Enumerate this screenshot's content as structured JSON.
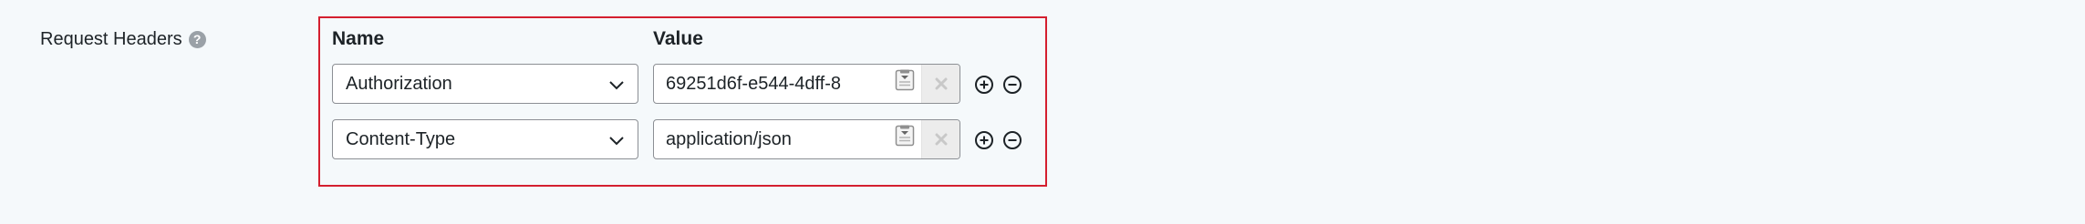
{
  "field": {
    "label": "Request Headers",
    "help_icon": "question-circle-icon"
  },
  "table": {
    "name_header": "Name",
    "value_header": "Value",
    "rows": [
      {
        "name": "Authorization",
        "value": "69251d6f-e544-4dff-8"
      },
      {
        "name": "Content-Type",
        "value": "application/json"
      }
    ]
  },
  "icons": {
    "dropdown": "chevron-down-icon",
    "clipboard": "clipboard-icon",
    "clear": "close-icon",
    "add": "plus-circle-icon",
    "remove": "minus-circle-icon"
  },
  "colors": {
    "highlight_border": "#d41f2f",
    "background": "#f5f9fb"
  }
}
